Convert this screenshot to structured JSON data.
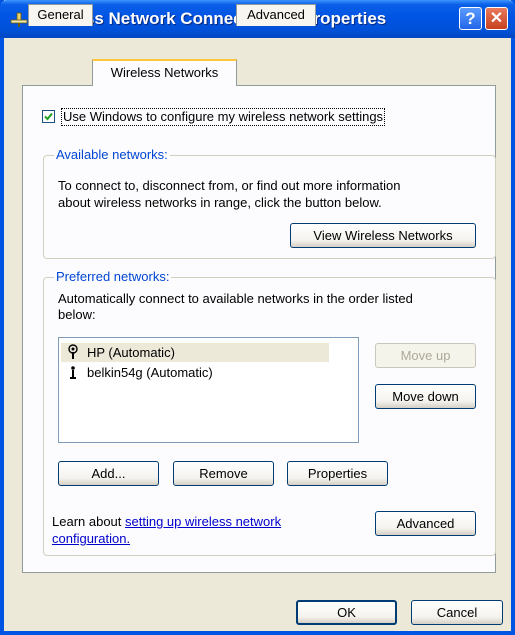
{
  "window": {
    "title": "Wireless Network Connection 27 Properties",
    "help_glyph": "?",
    "close_glyph": "✕"
  },
  "tabs": [
    {
      "label": "General",
      "active": false
    },
    {
      "label": "Wireless Networks",
      "active": true
    },
    {
      "label": "Advanced",
      "active": false
    }
  ],
  "use_windows": {
    "label": "Use Windows to configure my wireless network settings",
    "checked": true
  },
  "available": {
    "legend": "Available networks:",
    "text_line1": "To connect to, disconnect from, or find out more information",
    "text_line2": "about wireless networks in range, click the button below.",
    "button": "View Wireless Networks"
  },
  "preferred": {
    "legend": "Preferred networks:",
    "text_line1": "Automatically connect to available networks in the order listed",
    "text_line2": "below:",
    "networks": [
      {
        "label": "HP (Automatic)",
        "selected": true,
        "icon": "wireless-antenna-icon"
      },
      {
        "label": "belkin54g (Automatic)",
        "selected": false,
        "icon": "wireless-antenna-icon"
      }
    ],
    "move_up": "Move up",
    "move_down": "Move down",
    "add": "Add...",
    "remove": "Remove",
    "properties": "Properties"
  },
  "learn": {
    "prefix": "Learn about ",
    "link_line1": "setting up wireless network",
    "link_line2": "configuration."
  },
  "advanced_button": "Advanced",
  "footer": {
    "ok": "OK",
    "cancel": "Cancel"
  },
  "colors": {
    "titlebar": "#0054E3",
    "dialog": "#ECE9D8",
    "tab_highlight": "#FFC83C",
    "legend": "#0046D5",
    "link": "#0000CC"
  }
}
